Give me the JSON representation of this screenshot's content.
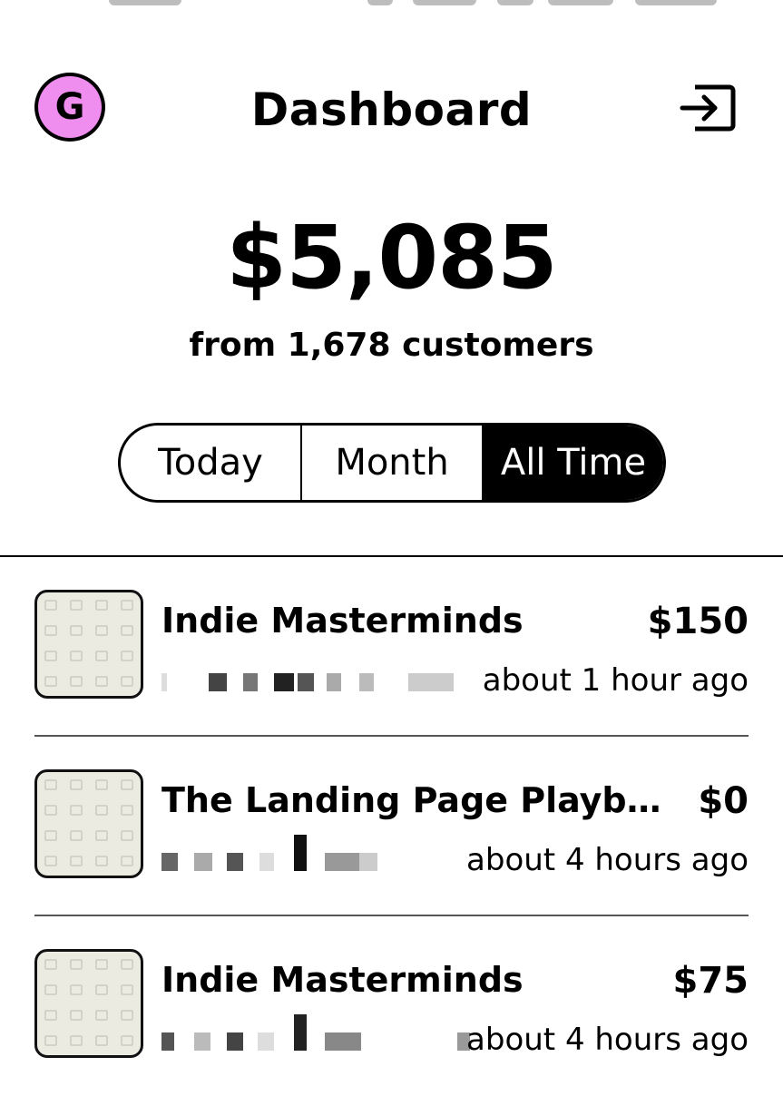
{
  "header": {
    "avatar_letter": "G",
    "title": "Dashboard",
    "logout_icon": "logout-icon"
  },
  "summary": {
    "total": "$5,085",
    "subtitle": "from 1,678 customers"
  },
  "period_tabs": [
    {
      "label": "Today",
      "active": false
    },
    {
      "label": "Month",
      "active": false
    },
    {
      "label": "All Time",
      "active": true
    }
  ],
  "sales": [
    {
      "product": "Indie Masterminds",
      "price": "$150",
      "time": "about 1 hour ago"
    },
    {
      "product": "The Landing Page Playboo...",
      "price": "$0",
      "time": "about 4 hours ago"
    },
    {
      "product": "Indie Masterminds",
      "price": "$75",
      "time": "about 4 hours ago"
    }
  ],
  "colors": {
    "avatar_bg": "#f08ef0",
    "active_tab_bg": "#000000",
    "thumbnail_bg": "#ecebe2"
  }
}
